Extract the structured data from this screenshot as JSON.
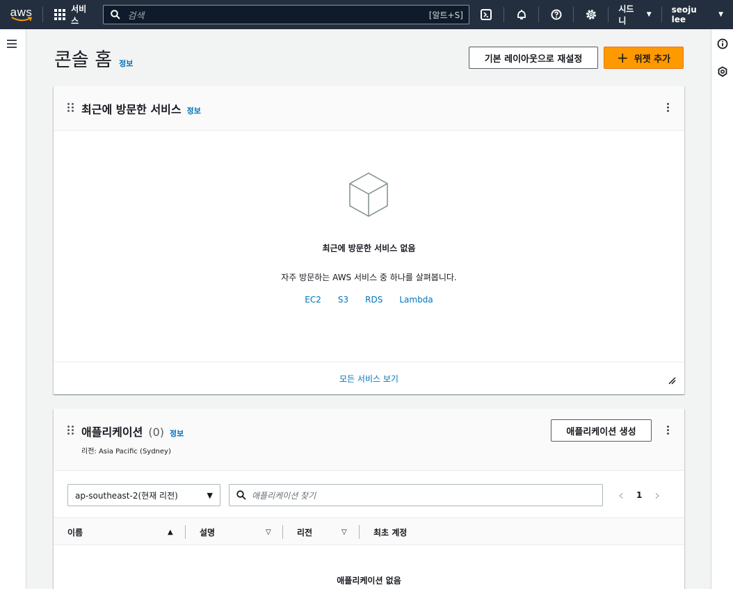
{
  "nav": {
    "logo_text": "aws",
    "services_label": "서비스",
    "search_placeholder": "검색",
    "search_shortcut": "[알트+S]",
    "region_label": "시드니",
    "user_label": "seoju lee"
  },
  "page": {
    "title": "콘솔 홈",
    "info_label": "정보",
    "reset_layout_label": "기본 레이아웃으로 재설정",
    "add_widget_label": "위젯 추가"
  },
  "recent_services": {
    "title": "최근에 방문한 서비스",
    "info_label": "정보",
    "empty_title": "최근에 방문한 서비스 없음",
    "empty_desc": "자주 방문하는 AWS 서비스 중 하나를 살펴봅니다.",
    "links": [
      "EC2",
      "S3",
      "RDS",
      "Lambda"
    ],
    "footer_link": "모든 서비스 보기"
  },
  "applications": {
    "title": "애플리케이션",
    "count": "(0)",
    "info_label": "정보",
    "region_text": "리전: Asia Pacific (Sydney)",
    "create_label": "애플리케이션 생성",
    "region_select_value": "ap-southeast-2(현재 리전)",
    "search_placeholder": "애플리케이션 찾기",
    "page_number": "1",
    "columns": [
      "이름",
      "설명",
      "리전",
      "최초 계정"
    ],
    "empty_title": "애플리케이션 없음"
  },
  "colors": {
    "nav_bg": "#232f3e",
    "primary": "#ff9900",
    "link": "#0073bb"
  }
}
